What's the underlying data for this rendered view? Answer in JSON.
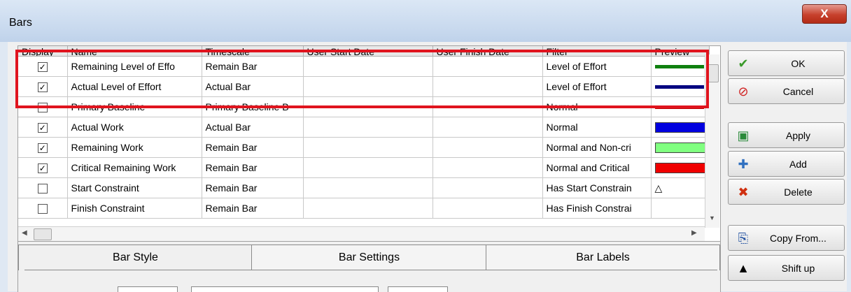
{
  "window": {
    "title": "Bars",
    "close_glyph": "X"
  },
  "table": {
    "columns": [
      "Display",
      "Name",
      "Timescale",
      "User Start Date",
      "User Finish Date",
      "Filter",
      "Preview"
    ],
    "rows": [
      {
        "checked": true,
        "name": "Remaining Level of Effo",
        "timescale": "Remain Bar",
        "start": "",
        "finish": "",
        "filter": "Level of Effort",
        "preview": {
          "kind": "line",
          "color": "#108010"
        }
      },
      {
        "checked": true,
        "name": "Actual Level of Effort",
        "timescale": "Actual Bar",
        "start": "",
        "finish": "",
        "filter": "Level of Effort",
        "preview": {
          "kind": "line",
          "color": "#000080"
        }
      },
      {
        "checked": false,
        "name": "Primary Baseline",
        "timescale": "Primary Baseline B",
        "start": "",
        "finish": "",
        "filter": "Normal",
        "preview": {
          "kind": "line",
          "color": "#c00000"
        }
      },
      {
        "checked": true,
        "name": "Actual Work",
        "timescale": "Actual Bar",
        "start": "",
        "finish": "",
        "filter": "Normal",
        "preview": {
          "kind": "bar",
          "color": "#0000e0"
        }
      },
      {
        "checked": true,
        "name": "Remaining Work",
        "timescale": "Remain Bar",
        "start": "",
        "finish": "",
        "filter": "Normal and Non-cri",
        "preview": {
          "kind": "bar",
          "color": "#80ff80"
        }
      },
      {
        "checked": true,
        "name": "Critical Remaining Work",
        "timescale": "Remain Bar",
        "start": "",
        "finish": "",
        "filter": "Normal and Critical",
        "preview": {
          "kind": "bar",
          "color": "#f00000"
        }
      },
      {
        "checked": false,
        "name": "Start Constraint",
        "timescale": "Remain Bar",
        "start": "",
        "finish": "",
        "filter": "Has Start Constrain",
        "preview": {
          "kind": "glyph",
          "glyph": "△",
          "icon": "start-constraint-icon"
        }
      },
      {
        "checked": false,
        "name": "Finish Constraint",
        "timescale": "Remain Bar",
        "start": "",
        "finish": "",
        "filter": "Has Finish Constrai",
        "preview": {
          "kind": "none"
        }
      }
    ]
  },
  "buttons": [
    {
      "id": "ok",
      "label": "OK",
      "icon": "checkmark-icon",
      "glyph": "✔",
      "color": "#3a9a2a"
    },
    {
      "id": "cancel",
      "label": "Cancel",
      "icon": "cancel-icon",
      "glyph": "⊘",
      "color": "#d02020"
    },
    {
      "id": "apply",
      "label": "Apply",
      "icon": "apply-icon",
      "glyph": "▣",
      "color": "#2a8a3a"
    },
    {
      "id": "add",
      "label": "Add",
      "icon": "add-icon",
      "glyph": "✚",
      "color": "#3070c0"
    },
    {
      "id": "delete",
      "label": "Delete",
      "icon": "delete-icon",
      "glyph": "✖",
      "color": "#d03010"
    },
    {
      "id": "copy-from",
      "label": "Copy From...",
      "icon": "copy-icon",
      "glyph": "⎘",
      "color": "#2050a0"
    },
    {
      "id": "shift-up",
      "label": "Shift up",
      "icon": "arrow-up-icon",
      "glyph": "▲",
      "color": "#000000"
    }
  ],
  "tabs": [
    {
      "label": "Bar Style",
      "active": true
    },
    {
      "label": "Bar Settings",
      "active": false
    },
    {
      "label": "Bar Labels",
      "active": false
    }
  ],
  "colors": {
    "highlight": "#e0141e",
    "window_bg": "#f0f0f0"
  }
}
